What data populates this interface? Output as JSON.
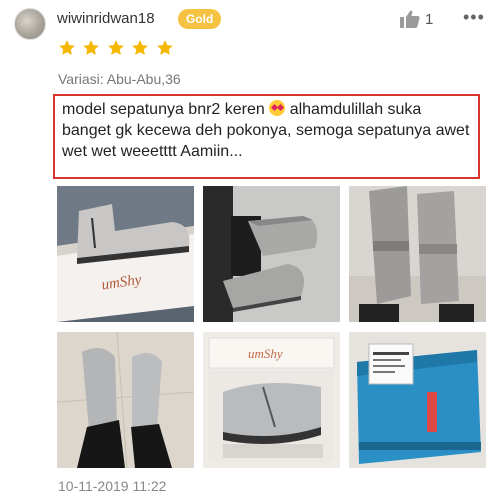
{
  "review": {
    "username": "wiwinridwan18",
    "badge": "Gold",
    "likes": "1",
    "more_icon": "more-horizontal-icon",
    "rating": 5,
    "variation": "Variasi: Abu-Abu,36",
    "text_before_emoji": "model sepatunya bnr2 keren ",
    "emoji": "heart-eyes-emoji",
    "text_after_emoji": " alhamdulillah suka banget gk kecewa deh pokonya, semoga sepatunya awet wet wet weeetttt Aamiin...",
    "date": "10-11-2019 11:22"
  },
  "photos": [
    {
      "name": "photo-box-side",
      "brand": "umShy"
    },
    {
      "name": "photo-feet-floor"
    },
    {
      "name": "photo-feet-top"
    },
    {
      "name": "photo-feet-standing"
    },
    {
      "name": "photo-box-open",
      "brand": "umShy"
    },
    {
      "name": "photo-package"
    }
  ],
  "colors": {
    "badge": "#f5c242",
    "stars": "#f5b800",
    "highlight_border": "#d9332f"
  }
}
